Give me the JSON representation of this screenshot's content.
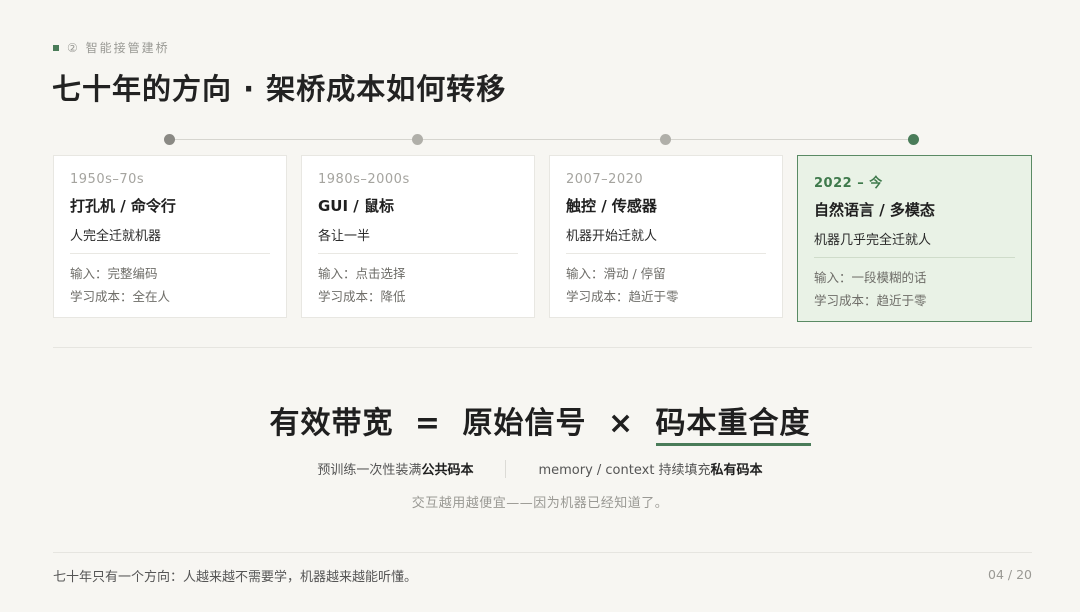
{
  "header": {
    "section_label": "② 智能接管建桥",
    "title": "七十年的方向 · 架桥成本如何转移"
  },
  "eras": [
    {
      "years": "1950s–70s",
      "interface": "打孔机 / 命令行",
      "summary": "人完全迁就机器",
      "input": "输入：完整编码",
      "learning_cost": "学习成本：全在人"
    },
    {
      "years": "1980s–2000s",
      "interface": "GUI / 鼠标",
      "summary": "各让一半",
      "input": "输入：点击选择",
      "learning_cost": "学习成本：降低"
    },
    {
      "years": "2007–2020",
      "interface": "触控 / 传感器",
      "summary": "机器开始迁就人",
      "input": "输入：滑动 / 停留",
      "learning_cost": "学习成本：趋近于零"
    },
    {
      "years": "2022 – 今",
      "interface": "自然语言 / 多模态",
      "summary": "机器几乎完全迁就人",
      "input": "输入：一段模糊的话",
      "learning_cost": "学习成本：趋近于零"
    }
  ],
  "formula": {
    "left": "有效带宽",
    "equals": "=",
    "term1": "原始信号",
    "times": "×",
    "term2": "码本重合度"
  },
  "explain": {
    "left_prefix": "预训练一次性装满",
    "left_bold": "公共码本",
    "right_prefix": "memory / context 持续填充",
    "right_bold": "私有码本"
  },
  "note": "交互越用越便宜——因为机器已经知道了。",
  "footer": {
    "text": "七十年只有一个方向：人越来越不需要学，机器越来越能听懂。",
    "page": "04 / 20"
  },
  "colors": {
    "accent": "#4a7c59",
    "highlight_card_bg": "#e9f2e6",
    "background": "#f7f6f2"
  }
}
